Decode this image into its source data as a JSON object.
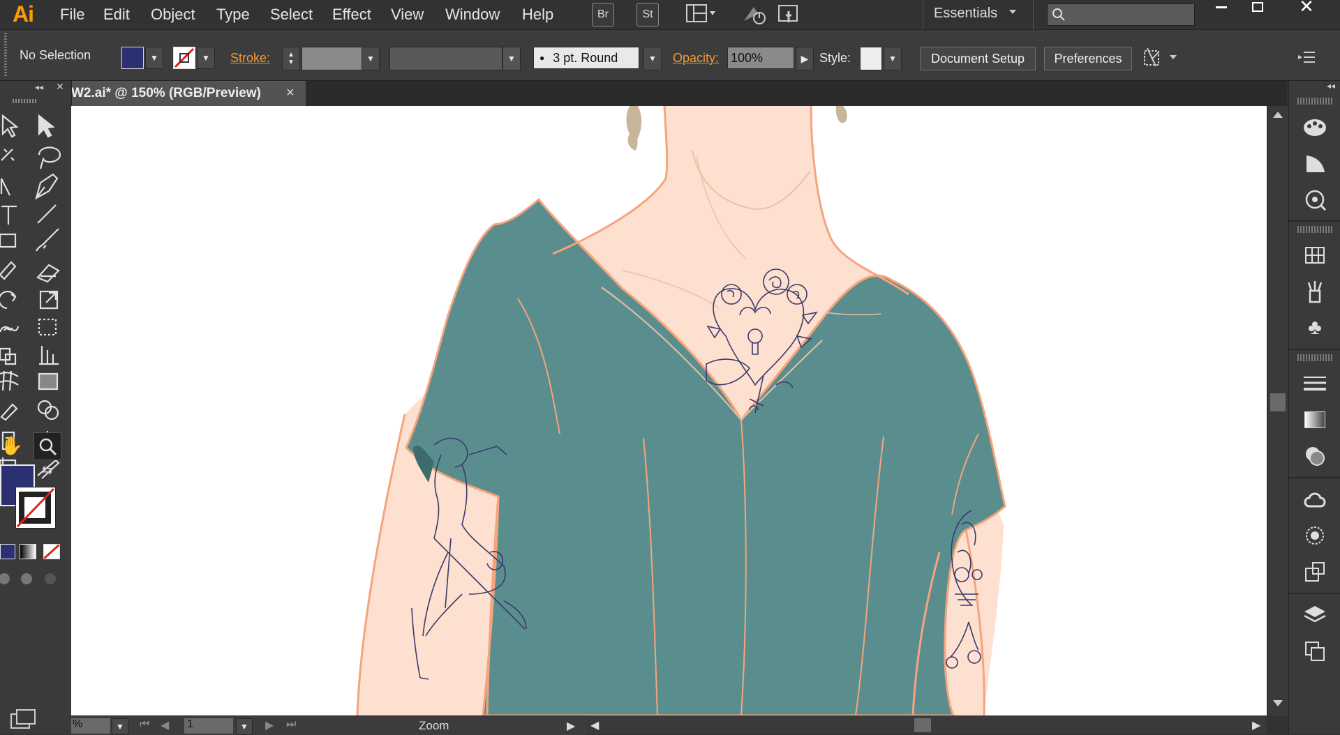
{
  "app": {
    "logo": "Ai"
  },
  "menu": [
    "File",
    "Edit",
    "Object",
    "Type",
    "Select",
    "Effect",
    "View",
    "Window",
    "Help"
  ],
  "menubar": {
    "bridge": "Br",
    "stock": "St",
    "workspace": "Essentials",
    "window_controls": [
      "minimize-icon",
      "maximize-icon",
      "close-icon"
    ]
  },
  "control_bar": {
    "selection": "No Selection",
    "fill_color": "#2b3170",
    "stroke_label": "Stroke:",
    "brush": "3 pt. Round",
    "opacity_label": "Opacity:",
    "opacity_value": "100%",
    "style_label": "Style:",
    "document_setup": "Document Setup",
    "preferences": "Preferences"
  },
  "document": {
    "tab_title": "W2.ai* @ 150% (RGB/Preview)",
    "close": "×"
  },
  "status": {
    "zoom_value": "%",
    "artboard": "1",
    "mode": "Zoom"
  },
  "colors": {
    "fill": "#2b3170",
    "skin": "#fde0cf",
    "outline": "#f5a47c",
    "shirt": "#5a8e8e",
    "tattoo": "#3a3a6a",
    "accent": "#f29a2e"
  }
}
